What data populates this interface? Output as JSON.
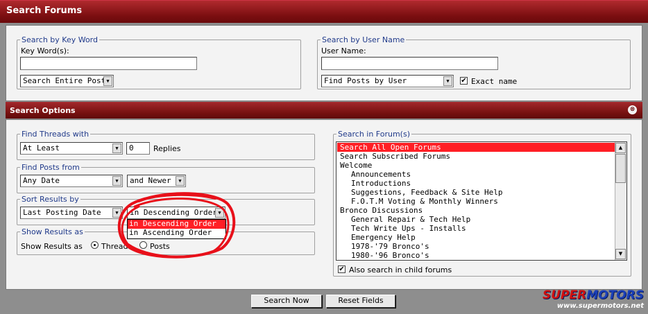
{
  "header": {
    "title": "Search Forums"
  },
  "keyword": {
    "legend": "Search by Key Word",
    "label": "Key Word(s):",
    "value": "",
    "scope_select": "Search Entire Posts"
  },
  "user": {
    "legend": "Search by User Name",
    "label": "User Name:",
    "value": "",
    "find_select": "Find Posts by User",
    "exact_label": "Exact name",
    "exact_checked": "✔"
  },
  "options": {
    "title": "Search Options",
    "collapse_icon": "⊗"
  },
  "threads": {
    "legend": "Find Threads with",
    "select": "At Least",
    "replies_value": "0",
    "replies_label": "Replies"
  },
  "posts_from": {
    "legend": "Find Posts from",
    "date_select": "Any Date",
    "newer_select": "and Newer"
  },
  "sort": {
    "legend": "Sort Results by",
    "field_select": "Last Posting Date",
    "order_select": "in Descending Order",
    "order_options": [
      "in Descending Order",
      "in Ascending Order"
    ]
  },
  "show": {
    "legend": "Show Results as",
    "label": "Show Results as",
    "threads_label": "Threads",
    "posts_label": "Posts"
  },
  "forums": {
    "legend": "Search in Forum(s)",
    "items": [
      {
        "label": "Search All Open Forums",
        "indent": false,
        "selected": true
      },
      {
        "label": "Search Subscribed Forums",
        "indent": false
      },
      {
        "label": "Welcome",
        "indent": false
      },
      {
        "label": "Announcements",
        "indent": true
      },
      {
        "label": "Introductions",
        "indent": true
      },
      {
        "label": "Suggestions, Feedback & Site Help",
        "indent": true
      },
      {
        "label": "F.O.T.M Voting & Monthly Winners",
        "indent": true
      },
      {
        "label": "Bronco Discussions",
        "indent": false
      },
      {
        "label": "General Repair & Tech Help",
        "indent": true
      },
      {
        "label": "Tech Write Ups - Installs",
        "indent": true
      },
      {
        "label": "Emergency Help",
        "indent": true
      },
      {
        "label": "1978-'79 Bronco's",
        "indent": true
      },
      {
        "label": "1980-'96 Bronco's",
        "indent": true
      }
    ],
    "child_label": "Also search in child forums",
    "child_checked": "✔"
  },
  "buttons": {
    "search": "Search Now",
    "reset": "Reset Fields"
  },
  "watermark": {
    "brand_a": "SUPER",
    "brand_b": "MOTORS",
    "url": "www.supermotors.net"
  },
  "colors": {
    "header": "#7a0e10",
    "selection": "#ff1f25",
    "annotation": "#e8101a",
    "legend": "#203a8a"
  }
}
